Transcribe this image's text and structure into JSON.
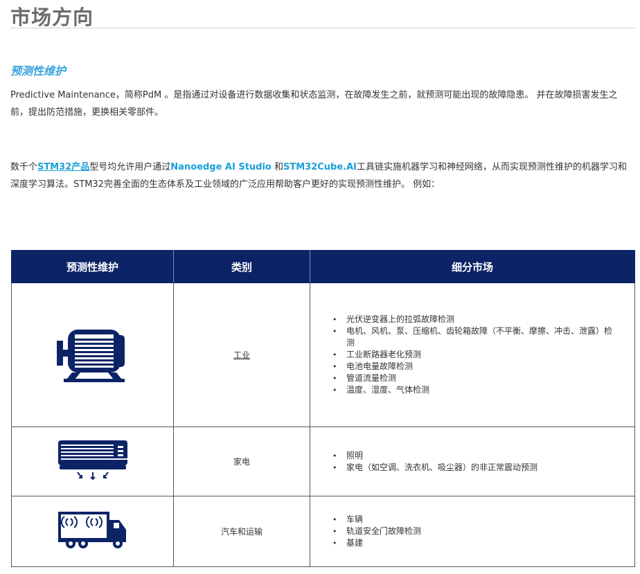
{
  "page": {
    "title": "市场方向"
  },
  "section": {
    "heading": "预测性维护"
  },
  "intro": "Predictive Maintenance，简称PdM 。是指通过对设备进行数据收集和状态监测，在故障发生之前，就预测可能出现的故障隐患。 并在故障损害发生之前，提出防范措施，更换相关零部件。",
  "description": {
    "part1": "数千个",
    "link_products": "STM32产品",
    "part2": "型号均允许用户通过",
    "tool1": "Nanoedge AI Studio",
    "part3": " 和",
    "tool2": "STM32Cube.AI",
    "part4": "工具链实施机器学习和神经网络，从而实现预测性维护的机器学习和深度学习算法。STM32完善全面的生态体系及工业领域的广泛应用帮助客户更好的实现预测性维护。 例如："
  },
  "table": {
    "headers": [
      "预测性维护",
      "类别",
      "细分市场"
    ],
    "rows": [
      {
        "icon": "electric-motor-icon",
        "category": "工业",
        "items": [
          "光伏逆变器上的拉弧故障检测",
          "电机、风机、泵、压缩机、齿轮箱故障（不平衡、摩擦、冲击、泄露）检测",
          "工业断路器老化预测",
          "电池电量故障检测",
          "管道流量检测",
          "温度、湿度、气体检测"
        ]
      },
      {
        "icon": "air-conditioner-icon",
        "category": "家电",
        "items": [
          " 照明",
          " 家电（如空调、洗衣机、吸尘器）的非正常震动预测"
        ]
      },
      {
        "icon": "truck-icon",
        "category": "汽车和运输",
        "items": [
          "车辆",
          "轨道安全门故障检测",
          "基建"
        ]
      }
    ]
  },
  "colors": {
    "navy": "#0c2366",
    "accent": "#1b9fd8",
    "title_gray": "#6b6b6b"
  }
}
